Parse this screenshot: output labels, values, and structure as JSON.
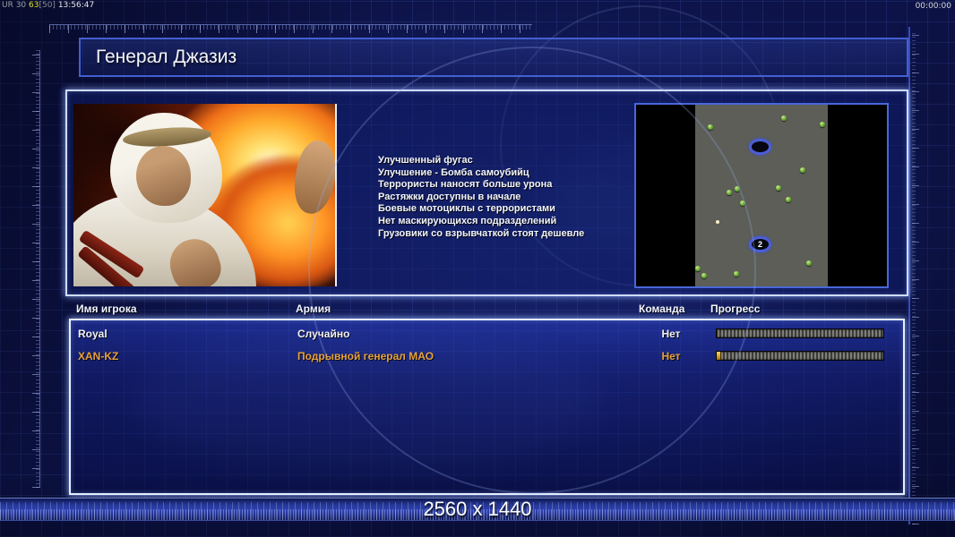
{
  "hud": {
    "left": {
      "prefix": "UR 30 ",
      "fps": "63",
      "bracket": "[50]",
      "clock": " 13:56:47"
    },
    "timer": "00:00:00"
  },
  "header": {
    "title": "Генерал Джазиз"
  },
  "briefing": {
    "bonuses": [
      "Улучшенный фугас",
      "Улучшение - Бомба самоубийц",
      "Террористы наносят больше урона",
      "Растяжки доступны в начале",
      "Боевые мотоциклы с террористами",
      "Нет маскирующихся подразделений",
      "Грузовики со взрывчаткой стоят дешевле"
    ]
  },
  "minimap": {
    "trees": [
      [
        29.6,
        12.1
      ],
      [
        58.8,
        7.2
      ],
      [
        74.3,
        10.6
      ],
      [
        66.5,
        36.2
      ],
      [
        37.3,
        48.3
      ],
      [
        40.5,
        46.4
      ],
      [
        56.7,
        45.9
      ],
      [
        60.6,
        52.2
      ],
      [
        42.6,
        54.1
      ],
      [
        69.0,
        87.0
      ],
      [
        24.6,
        90.3
      ],
      [
        27.0,
        94.0
      ],
      [
        40.1,
        93.2
      ]
    ],
    "white_dot": [
      32.4,
      64.7
    ],
    "start_markers": [
      {
        "x": 49.3,
        "y": 23.2,
        "label": ""
      },
      {
        "x": 49.3,
        "y": 76.8,
        "label": "2"
      }
    ]
  },
  "roster": {
    "headers": {
      "player": "Имя игрока",
      "army": "Армия",
      "team": "Команда",
      "progress": "Прогресс"
    },
    "rows": [
      {
        "player": "Royal",
        "army": "Случайно",
        "team": "Нет",
        "progress_segments": 0,
        "color": "#f2f2f2"
      },
      {
        "player": "XAN-KZ",
        "army": "Подрывной генерал МАО",
        "team": "Нет",
        "progress_segments": 1,
        "color": "#e8a23a"
      }
    ]
  },
  "footer": {
    "resolution": "2560 x 1440"
  },
  "colors": {
    "accent_gold": "#e8a23a",
    "panel_glow": "#e6eeff",
    "tree_green": "#74b23e",
    "marker_ring": "#4c5ed6",
    "progress_fill": "#d89c24"
  }
}
